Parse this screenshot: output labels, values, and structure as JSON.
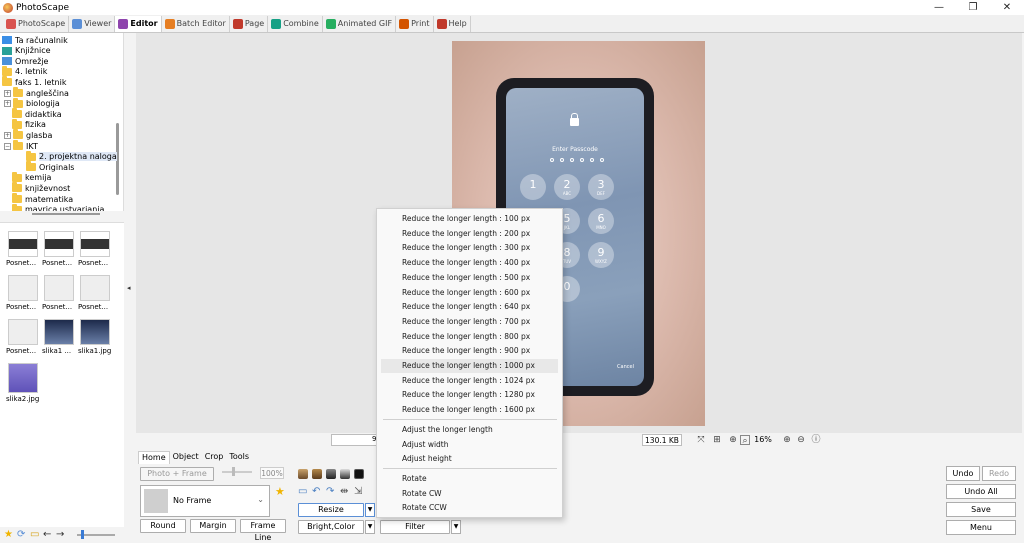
{
  "window": {
    "title": "PhotoScape",
    "minimize": "—",
    "restore": "❐",
    "close": "✕"
  },
  "tabs": [
    {
      "label": "PhotoScape",
      "color": "#d9534f"
    },
    {
      "label": "Viewer",
      "color": "#5b8fd6"
    },
    {
      "label": "Editor",
      "color": "#8e44ad"
    },
    {
      "label": "Batch Editor",
      "color": "#e67e22"
    },
    {
      "label": "Page",
      "color": "#c0392b"
    },
    {
      "label": "Combine",
      "color": "#16a085"
    },
    {
      "label": "Animated GIF",
      "color": "#27ae60"
    },
    {
      "label": "Print",
      "color": "#d35400"
    },
    {
      "label": "Help",
      "color": "#c0392b"
    }
  ],
  "folder_tree": [
    {
      "label": "Ta računalnik",
      "icon": "pc",
      "expander": ""
    },
    {
      "label": "Knjižnice",
      "icon": "library",
      "expander": ""
    },
    {
      "label": "Omrežje",
      "icon": "network",
      "expander": ""
    },
    {
      "label": "4. letnik",
      "icon": "folder",
      "expander": ""
    },
    {
      "label": "faks 1. letnik",
      "icon": "folder",
      "expander": ""
    },
    {
      "label": "angleščina",
      "icon": "folder",
      "expander": "+"
    },
    {
      "label": "biologija",
      "icon": "folder",
      "expander": "+"
    },
    {
      "label": "didaktika",
      "icon": "folder",
      "expander": ""
    },
    {
      "label": "fizika",
      "icon": "folder",
      "expander": ""
    },
    {
      "label": "glasba",
      "icon": "folder",
      "expander": "+"
    },
    {
      "label": "IKT",
      "icon": "folder",
      "expander": "−"
    },
    {
      "label": "2. projektna naloga",
      "icon": "folder",
      "expander": ""
    },
    {
      "label": "Originals",
      "icon": "folder",
      "expander": ""
    },
    {
      "label": "kemija",
      "icon": "folder",
      "expander": ""
    },
    {
      "label": "književnost",
      "icon": "folder",
      "expander": ""
    },
    {
      "label": "matematika",
      "icon": "folder",
      "expander": ""
    },
    {
      "label": "mavrica ustvarjanja",
      "icon": "folder",
      "expander": ""
    }
  ],
  "thumbnails": [
    {
      "label": "Posnet..."
    },
    {
      "label": "Posnet..."
    },
    {
      "label": "Posnet..."
    },
    {
      "label": "Posnet..."
    },
    {
      "label": "Posnet..."
    },
    {
      "label": "Posnet..."
    },
    {
      "label": "Posnet..."
    },
    {
      "label": "slika1 ..."
    },
    {
      "label": "slika1.jpg"
    },
    {
      "label": "slika2.jpg"
    }
  ],
  "photo": {
    "passcode_label": "Enter Passcode",
    "cancel_label": "Cancel",
    "keys": [
      {
        "digit": "1",
        "letters": ""
      },
      {
        "digit": "2",
        "letters": "ABC"
      },
      {
        "digit": "3",
        "letters": "DEF"
      },
      {
        "digit": "4",
        "letters": "GHI"
      },
      {
        "digit": "5",
        "letters": "JKL"
      },
      {
        "digit": "6",
        "letters": "MNO"
      },
      {
        "digit": "7",
        "letters": "PQRS"
      },
      {
        "digit": "8",
        "letters": "TUV"
      },
      {
        "digit": "9",
        "letters": "WXYZ"
      },
      {
        "digit": "0",
        "letters": ""
      }
    ]
  },
  "status": {
    "info_prefix": "9",
    "filesize": "130.1 KB",
    "zoom": "16%"
  },
  "panel": {
    "tabs": [
      "Home",
      "Object",
      "Crop",
      "Tools"
    ],
    "photo_frame_button": "Photo + Frame",
    "percent": "100%",
    "frame_select": "No Frame",
    "round_button": "Round",
    "margin_button": "Margin",
    "frame_line_button": "Frame Line",
    "resize_button": "Resize",
    "bright_color_button": "Bright,Color",
    "filter_button": "Filter"
  },
  "right_buttons": {
    "undo": "Undo",
    "redo": "Redo",
    "undo_all": "Undo All",
    "save": "Save",
    "menu": "Menu"
  },
  "resize_menu": {
    "items": [
      "Reduce the longer length : 100 px",
      "Reduce the longer length : 200 px",
      "Reduce the longer length : 300 px",
      "Reduce the longer length : 400 px",
      "Reduce the longer length : 500 px",
      "Reduce the longer length : 600 px",
      "Reduce the longer length : 640 px",
      "Reduce the longer length : 700 px",
      "Reduce the longer length : 800 px",
      "Reduce the longer length : 900 px",
      "Reduce the longer length : 1000 px",
      "Reduce the longer length : 1024 px",
      "Reduce the longer length : 1280 px",
      "Reduce the longer length : 1600 px"
    ],
    "hovered_item": "Reduce the longer length : 1000 px",
    "adjust_items": [
      "Adjust the longer length",
      "Adjust width",
      "Adjust height"
    ],
    "rotate_items": [
      "Rotate",
      "Rotate CW",
      "Rotate CCW"
    ]
  }
}
